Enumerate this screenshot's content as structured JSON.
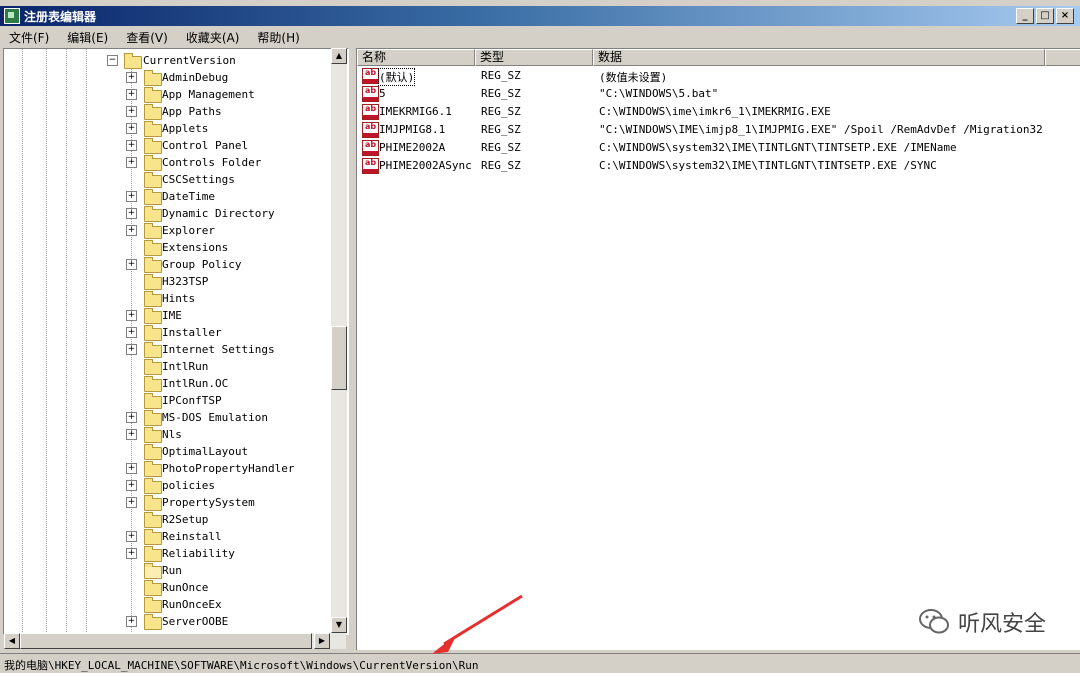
{
  "window": {
    "title": "注册表编辑器",
    "buttons": [
      "_",
      "□",
      "×"
    ]
  },
  "menu": [
    "文件(F)",
    "编辑(E)",
    "查看(V)",
    "收藏夹(A)",
    "帮助(H)"
  ],
  "tree": {
    "parent": {
      "label": "CurrentVersion",
      "expander": "−"
    },
    "items": [
      {
        "label": "AdminDebug",
        "expander": "+"
      },
      {
        "label": "App Management",
        "expander": "+"
      },
      {
        "label": "App Paths",
        "expander": "+"
      },
      {
        "label": "Applets",
        "expander": "+"
      },
      {
        "label": "Control Panel",
        "expander": "+"
      },
      {
        "label": "Controls Folder",
        "expander": "+"
      },
      {
        "label": "CSCSettings",
        "expander": ""
      },
      {
        "label": "DateTime",
        "expander": "+"
      },
      {
        "label": "Dynamic Directory",
        "expander": "+"
      },
      {
        "label": "Explorer",
        "expander": "+"
      },
      {
        "label": "Extensions",
        "expander": ""
      },
      {
        "label": "Group Policy",
        "expander": "+"
      },
      {
        "label": "H323TSP",
        "expander": ""
      },
      {
        "label": "Hints",
        "expander": ""
      },
      {
        "label": "IME",
        "expander": "+"
      },
      {
        "label": "Installer",
        "expander": "+"
      },
      {
        "label": "Internet Settings",
        "expander": "+"
      },
      {
        "label": "IntlRun",
        "expander": ""
      },
      {
        "label": "IntlRun.OC",
        "expander": ""
      },
      {
        "label": "IPConfTSP",
        "expander": ""
      },
      {
        "label": "MS-DOS Emulation",
        "expander": "+"
      },
      {
        "label": "Nls",
        "expander": "+"
      },
      {
        "label": "OptimalLayout",
        "expander": ""
      },
      {
        "label": "PhotoPropertyHandler",
        "expander": "+"
      },
      {
        "label": "policies",
        "expander": "+"
      },
      {
        "label": "PropertySystem",
        "expander": "+"
      },
      {
        "label": "R2Setup",
        "expander": ""
      },
      {
        "label": "Reinstall",
        "expander": "+"
      },
      {
        "label": "Reliability",
        "expander": "+"
      },
      {
        "label": "Run",
        "expander": "",
        "selected": true
      },
      {
        "label": "RunOnce",
        "expander": ""
      },
      {
        "label": "RunOnceEx",
        "expander": ""
      },
      {
        "label": "ServerOOBE",
        "expander": "+"
      }
    ]
  },
  "list": {
    "columns": [
      "名称",
      "类型",
      "数据"
    ],
    "icon_text": "ab",
    "rows": [
      {
        "name": "(默认)",
        "type": "REG_SZ",
        "data": "(数值未设置)"
      },
      {
        "name": "5",
        "type": "REG_SZ",
        "data": "\"C:\\WINDOWS\\5.bat\""
      },
      {
        "name": "IMEKRMIG6.1",
        "type": "REG_SZ",
        "data": "C:\\WINDOWS\\ime\\imkr6_1\\IMEKRMIG.EXE"
      },
      {
        "name": "IMJPMIG8.1",
        "type": "REG_SZ",
        "data": "\"C:\\WINDOWS\\IME\\imjp8_1\\IMJPMIG.EXE\" /Spoil /RemAdvDef /Migration32"
      },
      {
        "name": "PHIME2002A",
        "type": "REG_SZ",
        "data": "C:\\WINDOWS\\system32\\IME\\TINTLGNT\\TINTSETP.EXE /IMEName"
      },
      {
        "name": "PHIME2002ASync",
        "type": "REG_SZ",
        "data": "C:\\WINDOWS\\system32\\IME\\TINTLGNT\\TINTSETP.EXE /SYNC"
      }
    ]
  },
  "statusbar": {
    "path": "我的电脑\\HKEY_LOCAL_MACHINE\\SOFTWARE\\Microsoft\\Windows\\CurrentVersion\\Run"
  },
  "watermark": {
    "text": "听风安全"
  },
  "colors": {
    "titlebar": "#0a246a",
    "arrow": "#e53030",
    "face": "#d4d0c8"
  }
}
